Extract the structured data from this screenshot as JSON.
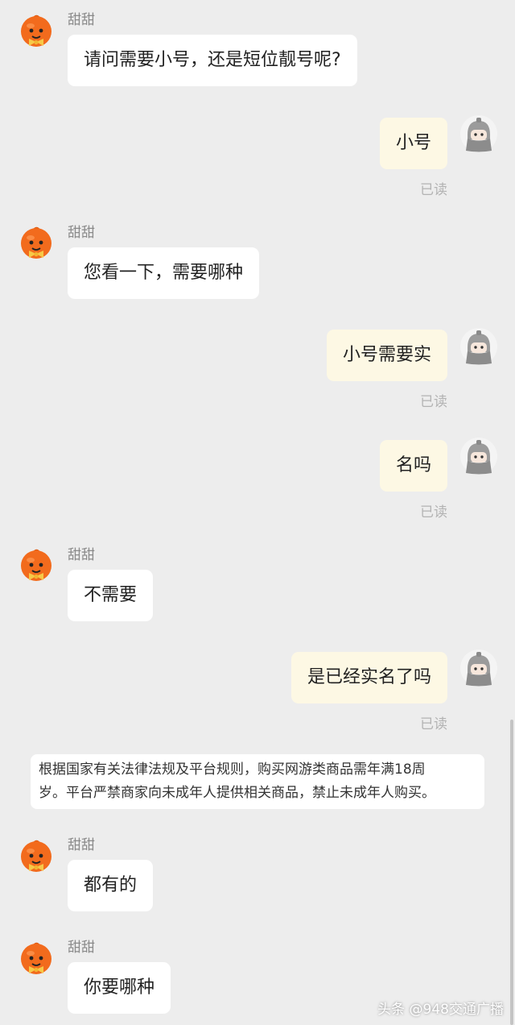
{
  "messages": [
    {
      "side": "left",
      "sender": "甜甜",
      "text": "请问需要小号，还是短位靓号呢?"
    },
    {
      "side": "right",
      "text": "小号",
      "status": "已读"
    },
    {
      "side": "left",
      "sender": "甜甜",
      "text": "您看一下，需要哪种"
    },
    {
      "side": "right",
      "text": "小号需要实"
    },
    {
      "side": "right",
      "text": "名吗",
      "status": "已读"
    },
    {
      "side": "left",
      "sender": "甜甜",
      "text": "不需要"
    },
    {
      "side": "right",
      "text": "是已经实名了吗",
      "status": "已读"
    },
    {
      "side": "notice",
      "lines": [
        "根据国家有关法律法规及平台规则，购买网游类商品需年满18周",
        "岁。平台严禁商家向未成年人提供相关商品，禁止未成年人购买。"
      ]
    },
    {
      "side": "left",
      "sender": "甜甜",
      "text": "都有的"
    },
    {
      "side": "left",
      "sender": "甜甜",
      "text": "你要哪种"
    }
  ],
  "watermark": "头条 @948交通广播",
  "icons": {
    "seller_avatar": "orange-mascot-icon",
    "user_avatar": "gray-helmet-avatar-icon"
  },
  "colors": {
    "background": "#ededed",
    "incoming_bubble": "#ffffff",
    "outgoing_bubble": "#fdf8e4",
    "read_status": "#b3b3b3"
  }
}
